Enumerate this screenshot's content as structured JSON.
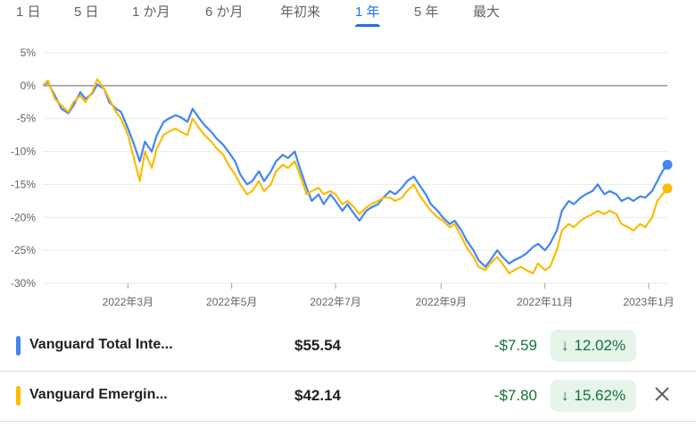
{
  "tabs": [
    {
      "label": "1 日",
      "active": false
    },
    {
      "label": "5 日",
      "active": false
    },
    {
      "label": "1 か月",
      "active": false
    },
    {
      "label": "6 か月",
      "active": false
    },
    {
      "label": "年初来",
      "active": false
    },
    {
      "label": "1 年",
      "active": true
    },
    {
      "label": "5 年",
      "active": false
    },
    {
      "label": "最大",
      "active": false
    }
  ],
  "funds": [
    {
      "name": "Vanguard Total Inte...",
      "price": "$55.54",
      "change": "-$7.59",
      "percent": "12.02%",
      "color": "#4285f4"
    },
    {
      "name": "Vanguard Emergin...",
      "price": "$42.14",
      "change": "-$7.80",
      "percent": "15.62%",
      "color": "#fbbc04"
    }
  ],
  "chart_data": {
    "type": "line",
    "y_unit": "%",
    "ylim": [
      -30,
      5
    ],
    "yticks": [
      "5%",
      "0%",
      "-5%",
      "-10%",
      "-15%",
      "-20%",
      "-25%",
      "-30%"
    ],
    "x_tick_labels": [
      "2022年3月",
      "2022年5月",
      "2022年7月",
      "2022年9月",
      "2022年11月",
      "2023年1月"
    ],
    "x_range": [
      "2022-01-10",
      "2023-01-12"
    ],
    "grid": "horizontal",
    "series": [
      {
        "name": "Vanguard Total Inte...",
        "color": "#4285f4",
        "points": [
          [
            "2022-01-10",
            0
          ],
          [
            "2022-01-13",
            0.5
          ],
          [
            "2022-01-17",
            -1.5
          ],
          [
            "2022-01-21",
            -3.5
          ],
          [
            "2022-01-25",
            -4.2
          ],
          [
            "2022-01-28",
            -3.0
          ],
          [
            "2022-02-01",
            -1.0
          ],
          [
            "2022-02-04",
            -2.0
          ],
          [
            "2022-02-08",
            -1.2
          ],
          [
            "2022-02-11",
            0.2
          ],
          [
            "2022-02-15",
            -0.5
          ],
          [
            "2022-02-18",
            -2.5
          ],
          [
            "2022-02-22",
            -3.5
          ],
          [
            "2022-02-25",
            -4.0
          ],
          [
            "2022-03-01",
            -6.5
          ],
          [
            "2022-03-04",
            -8.5
          ],
          [
            "2022-03-08",
            -11.5
          ],
          [
            "2022-03-11",
            -8.5
          ],
          [
            "2022-03-15",
            -10.0
          ],
          [
            "2022-03-18",
            -7.5
          ],
          [
            "2022-03-22",
            -5.5
          ],
          [
            "2022-03-25",
            -5.0
          ],
          [
            "2022-03-29",
            -4.5
          ],
          [
            "2022-04-01",
            -4.8
          ],
          [
            "2022-04-05",
            -5.5
          ],
          [
            "2022-04-08",
            -3.5
          ],
          [
            "2022-04-12",
            -5.0
          ],
          [
            "2022-04-15",
            -6.0
          ],
          [
            "2022-04-19",
            -7.0
          ],
          [
            "2022-04-22",
            -8.0
          ],
          [
            "2022-04-26",
            -9.0
          ],
          [
            "2022-04-29",
            -10.0
          ],
          [
            "2022-05-03",
            -11.5
          ],
          [
            "2022-05-06",
            -13.5
          ],
          [
            "2022-05-10",
            -15.0
          ],
          [
            "2022-05-13",
            -14.5
          ],
          [
            "2022-05-17",
            -13.0
          ],
          [
            "2022-05-20",
            -14.5
          ],
          [
            "2022-05-24",
            -13.0
          ],
          [
            "2022-05-27",
            -11.5
          ],
          [
            "2022-05-31",
            -10.5
          ],
          [
            "2022-06-03",
            -11.0
          ],
          [
            "2022-06-07",
            -10.0
          ],
          [
            "2022-06-10",
            -12.5
          ],
          [
            "2022-06-14",
            -15.5
          ],
          [
            "2022-06-17",
            -17.5
          ],
          [
            "2022-06-21",
            -16.5
          ],
          [
            "2022-06-24",
            -18.0
          ],
          [
            "2022-06-28",
            -16.5
          ],
          [
            "2022-07-01",
            -17.5
          ],
          [
            "2022-07-05",
            -19.0
          ],
          [
            "2022-07-08",
            -18.0
          ],
          [
            "2022-07-12",
            -19.5
          ],
          [
            "2022-07-15",
            -20.5
          ],
          [
            "2022-07-19",
            -19.0
          ],
          [
            "2022-07-22",
            -18.5
          ],
          [
            "2022-07-26",
            -18.0
          ],
          [
            "2022-07-29",
            -17.0
          ],
          [
            "2022-08-02",
            -16.0
          ],
          [
            "2022-08-05",
            -16.5
          ],
          [
            "2022-08-09",
            -15.5
          ],
          [
            "2022-08-12",
            -14.5
          ],
          [
            "2022-08-16",
            -13.8
          ],
          [
            "2022-08-19",
            -15.0
          ],
          [
            "2022-08-23",
            -16.5
          ],
          [
            "2022-08-26",
            -18.0
          ],
          [
            "2022-08-30",
            -19.0
          ],
          [
            "2022-09-02",
            -20.0
          ],
          [
            "2022-09-06",
            -21.0
          ],
          [
            "2022-09-09",
            -20.5
          ],
          [
            "2022-09-13",
            -22.0
          ],
          [
            "2022-09-16",
            -23.5
          ],
          [
            "2022-09-20",
            -25.0
          ],
          [
            "2022-09-23",
            -26.5
          ],
          [
            "2022-09-27",
            -27.5
          ],
          [
            "2022-09-30",
            -26.5
          ],
          [
            "2022-10-04",
            -25.0
          ],
          [
            "2022-10-07",
            -26.0
          ],
          [
            "2022-10-11",
            -27.0
          ],
          [
            "2022-10-14",
            -26.5
          ],
          [
            "2022-10-18",
            -26.0
          ],
          [
            "2022-10-21",
            -25.5
          ],
          [
            "2022-10-25",
            -24.5
          ],
          [
            "2022-10-28",
            -24.0
          ],
          [
            "2022-11-01",
            -25.0
          ],
          [
            "2022-11-04",
            -24.0
          ],
          [
            "2022-11-08",
            -22.0
          ],
          [
            "2022-11-11",
            -19.0
          ],
          [
            "2022-11-15",
            -17.5
          ],
          [
            "2022-11-18",
            -18.0
          ],
          [
            "2022-11-22",
            -17.0
          ],
          [
            "2022-11-25",
            -16.5
          ],
          [
            "2022-11-29",
            -16.0
          ],
          [
            "2022-12-02",
            -15.0
          ],
          [
            "2022-12-06",
            -16.5
          ],
          [
            "2022-12-09",
            -16.0
          ],
          [
            "2022-12-13",
            -16.5
          ],
          [
            "2022-12-16",
            -17.5
          ],
          [
            "2022-12-20",
            -17.0
          ],
          [
            "2022-12-23",
            -17.5
          ],
          [
            "2022-12-27",
            -16.8
          ],
          [
            "2022-12-30",
            -17.0
          ],
          [
            "2023-01-03",
            -16.0
          ],
          [
            "2023-01-06",
            -14.5
          ],
          [
            "2023-01-09",
            -13.0
          ],
          [
            "2023-01-12",
            -12.0
          ]
        ]
      },
      {
        "name": "Vanguard Emergin...",
        "color": "#fbbc04",
        "points": [
          [
            "2022-01-10",
            0
          ],
          [
            "2022-01-13",
            0.8
          ],
          [
            "2022-01-17",
            -2.0
          ],
          [
            "2022-01-21",
            -3.0
          ],
          [
            "2022-01-25",
            -4.0
          ],
          [
            "2022-01-28",
            -2.5
          ],
          [
            "2022-02-01",
            -1.5
          ],
          [
            "2022-02-04",
            -2.5
          ],
          [
            "2022-02-08",
            -1.0
          ],
          [
            "2022-02-11",
            1.0
          ],
          [
            "2022-02-15",
            -0.5
          ],
          [
            "2022-02-18",
            -2.0
          ],
          [
            "2022-02-22",
            -4.0
          ],
          [
            "2022-02-25",
            -5.0
          ],
          [
            "2022-03-01",
            -7.5
          ],
          [
            "2022-03-04",
            -10.5
          ],
          [
            "2022-03-08",
            -14.5
          ],
          [
            "2022-03-11",
            -10.0
          ],
          [
            "2022-03-15",
            -12.5
          ],
          [
            "2022-03-18",
            -9.5
          ],
          [
            "2022-03-22",
            -7.5
          ],
          [
            "2022-03-25",
            -7.0
          ],
          [
            "2022-03-29",
            -6.5
          ],
          [
            "2022-04-01",
            -7.0
          ],
          [
            "2022-04-05",
            -7.5
          ],
          [
            "2022-04-08",
            -5.0
          ],
          [
            "2022-04-12",
            -6.5
          ],
          [
            "2022-04-15",
            -7.5
          ],
          [
            "2022-04-19",
            -8.5
          ],
          [
            "2022-04-22",
            -9.5
          ],
          [
            "2022-04-26",
            -10.5
          ],
          [
            "2022-04-29",
            -12.0
          ],
          [
            "2022-05-03",
            -13.5
          ],
          [
            "2022-05-06",
            -15.0
          ],
          [
            "2022-05-10",
            -16.5
          ],
          [
            "2022-05-13",
            -16.0
          ],
          [
            "2022-05-17",
            -14.5
          ],
          [
            "2022-05-20",
            -16.0
          ],
          [
            "2022-05-24",
            -15.0
          ],
          [
            "2022-05-27",
            -13.0
          ],
          [
            "2022-05-31",
            -12.0
          ],
          [
            "2022-06-03",
            -12.5
          ],
          [
            "2022-06-07",
            -11.5
          ],
          [
            "2022-06-10",
            -13.5
          ],
          [
            "2022-06-14",
            -16.5
          ],
          [
            "2022-06-17",
            -16.0
          ],
          [
            "2022-06-21",
            -15.5
          ],
          [
            "2022-06-24",
            -16.5
          ],
          [
            "2022-06-28",
            -16.0
          ],
          [
            "2022-07-01",
            -16.5
          ],
          [
            "2022-07-05",
            -18.0
          ],
          [
            "2022-07-08",
            -17.5
          ],
          [
            "2022-07-12",
            -18.5
          ],
          [
            "2022-07-15",
            -19.5
          ],
          [
            "2022-07-19",
            -18.5
          ],
          [
            "2022-07-22",
            -18.0
          ],
          [
            "2022-07-26",
            -17.5
          ],
          [
            "2022-07-29",
            -17.0
          ],
          [
            "2022-08-02",
            -17.0
          ],
          [
            "2022-08-05",
            -17.5
          ],
          [
            "2022-08-09",
            -17.0
          ],
          [
            "2022-08-12",
            -16.0
          ],
          [
            "2022-08-16",
            -15.0
          ],
          [
            "2022-08-19",
            -16.5
          ],
          [
            "2022-08-23",
            -18.0
          ],
          [
            "2022-08-26",
            -19.0
          ],
          [
            "2022-08-30",
            -20.0
          ],
          [
            "2022-09-02",
            -20.5
          ],
          [
            "2022-09-06",
            -21.5
          ],
          [
            "2022-09-09",
            -21.0
          ],
          [
            "2022-09-13",
            -23.0
          ],
          [
            "2022-09-16",
            -24.5
          ],
          [
            "2022-09-20",
            -26.0
          ],
          [
            "2022-09-23",
            -27.5
          ],
          [
            "2022-09-27",
            -28.0
          ],
          [
            "2022-09-30",
            -27.0
          ],
          [
            "2022-10-04",
            -26.0
          ],
          [
            "2022-10-07",
            -27.0
          ],
          [
            "2022-10-11",
            -28.5
          ],
          [
            "2022-10-14",
            -28.0
          ],
          [
            "2022-10-18",
            -27.5
          ],
          [
            "2022-10-21",
            -28.0
          ],
          [
            "2022-10-25",
            -28.5
          ],
          [
            "2022-10-28",
            -27.0
          ],
          [
            "2022-11-01",
            -28.0
          ],
          [
            "2022-11-04",
            -27.5
          ],
          [
            "2022-11-08",
            -25.0
          ],
          [
            "2022-11-11",
            -22.0
          ],
          [
            "2022-11-15",
            -21.0
          ],
          [
            "2022-11-18",
            -21.5
          ],
          [
            "2022-11-22",
            -20.5
          ],
          [
            "2022-11-25",
            -20.0
          ],
          [
            "2022-11-29",
            -19.5
          ],
          [
            "2022-12-02",
            -19.0
          ],
          [
            "2022-12-06",
            -19.5
          ],
          [
            "2022-12-09",
            -19.0
          ],
          [
            "2022-12-13",
            -19.5
          ],
          [
            "2022-12-16",
            -21.0
          ],
          [
            "2022-12-20",
            -21.5
          ],
          [
            "2022-12-23",
            -22.0
          ],
          [
            "2022-12-27",
            -21.0
          ],
          [
            "2022-12-30",
            -21.5
          ],
          [
            "2023-01-03",
            -20.0
          ],
          [
            "2023-01-06",
            -17.5
          ],
          [
            "2023-01-09",
            -16.5
          ],
          [
            "2023-01-12",
            -15.6
          ]
        ]
      }
    ]
  }
}
